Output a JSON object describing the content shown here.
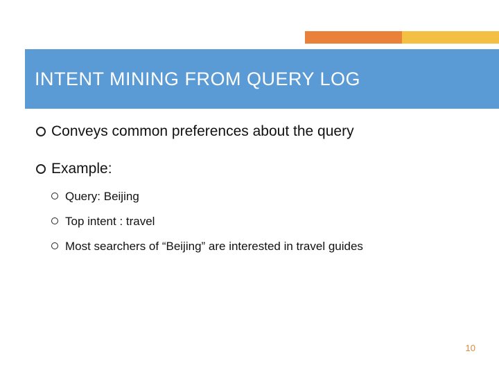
{
  "title": "INTENT MINING FROM QUERY LOG",
  "bullets": {
    "l1_a": "Conveys common preferences about the query",
    "l1_b": "Example:",
    "l2_a": "Query:  Beijing",
    "l2_b": "Top intent :  travel",
    "l2_c": "Most searchers of  “Beijing” are interested in travel guides"
  },
  "page_number": "10"
}
